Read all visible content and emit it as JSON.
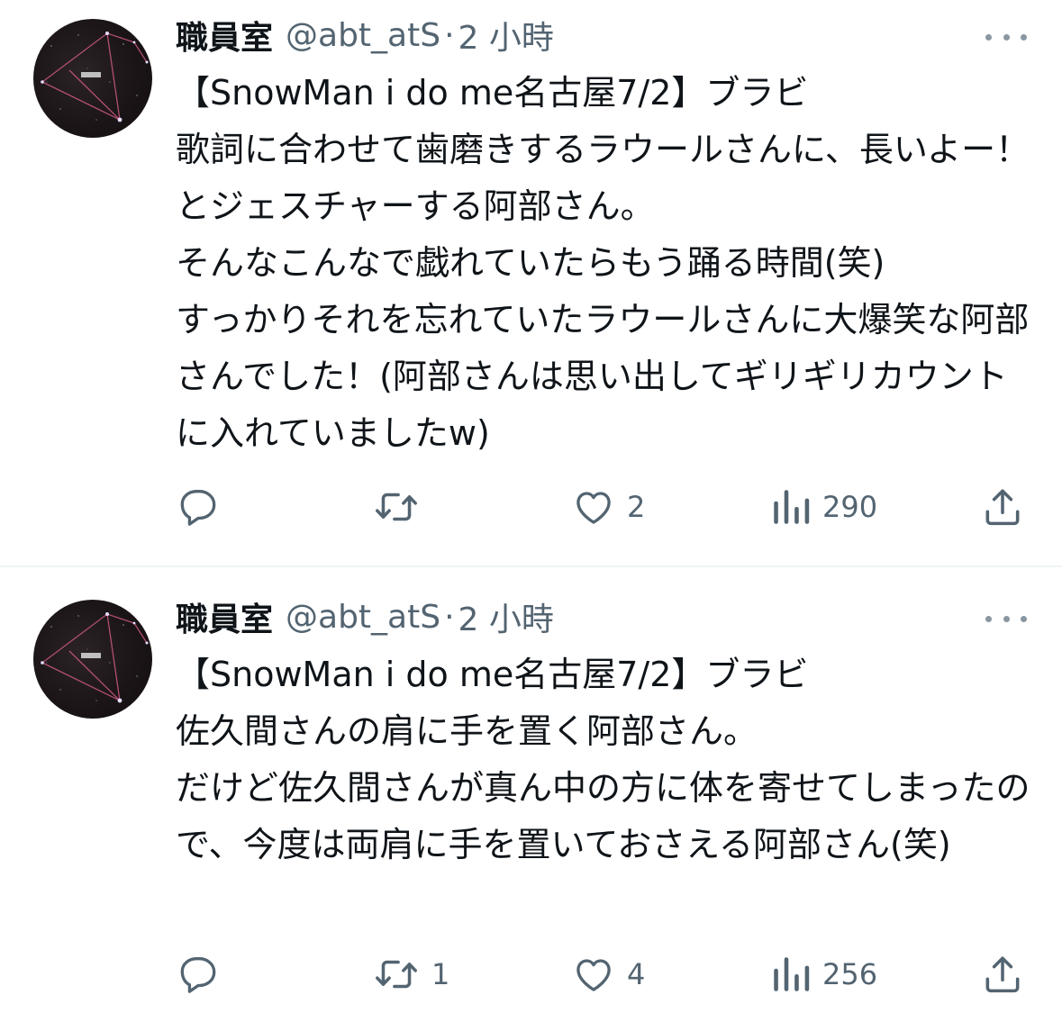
{
  "tweets": [
    {
      "name": "職員室",
      "handle": "@abt_atS",
      "separator": "·",
      "time": "2 小時",
      "text": "【SnowMan i do me名古屋7/2】ブラビ\n歌詞に合わせて歯磨きするラウールさんに、長いよー！とジェスチャーする阿部さん。\nそんなこんなで戯れていたらもう踊る時間(笑)\nすっかりそれを忘れていたラウールさんに大爆笑な阿部さんでした！(阿部さんは思い出してギリギリカウントに入れていましたw)",
      "stats": {
        "replies": "",
        "retweets": "",
        "likes": "2",
        "views": "290"
      }
    },
    {
      "name": "職員室",
      "handle": "@abt_atS",
      "separator": "·",
      "time": "2 小時",
      "text": "【SnowMan i do me名古屋7/2】ブラビ\n佐久間さんの肩に手を置く阿部さん。\nだけど佐久間さんが真ん中の方に体を寄せてしまったので、今度は両肩に手を置いておさえる阿部さん(笑)",
      "stats": {
        "replies": "",
        "retweets": "1",
        "likes": "4",
        "views": "256"
      }
    }
  ],
  "icons": {
    "reply": "speech-bubble-icon",
    "retweet": "retweet-arrows-icon",
    "like": "heart-icon",
    "views": "bar-chart-icon",
    "share": "share-upload-icon",
    "more": "more-dots-icon"
  },
  "colors": {
    "text": "#0f1419",
    "secondary": "#536471",
    "divider": "#eff3f4",
    "avatar_lines": "#c2567e"
  }
}
